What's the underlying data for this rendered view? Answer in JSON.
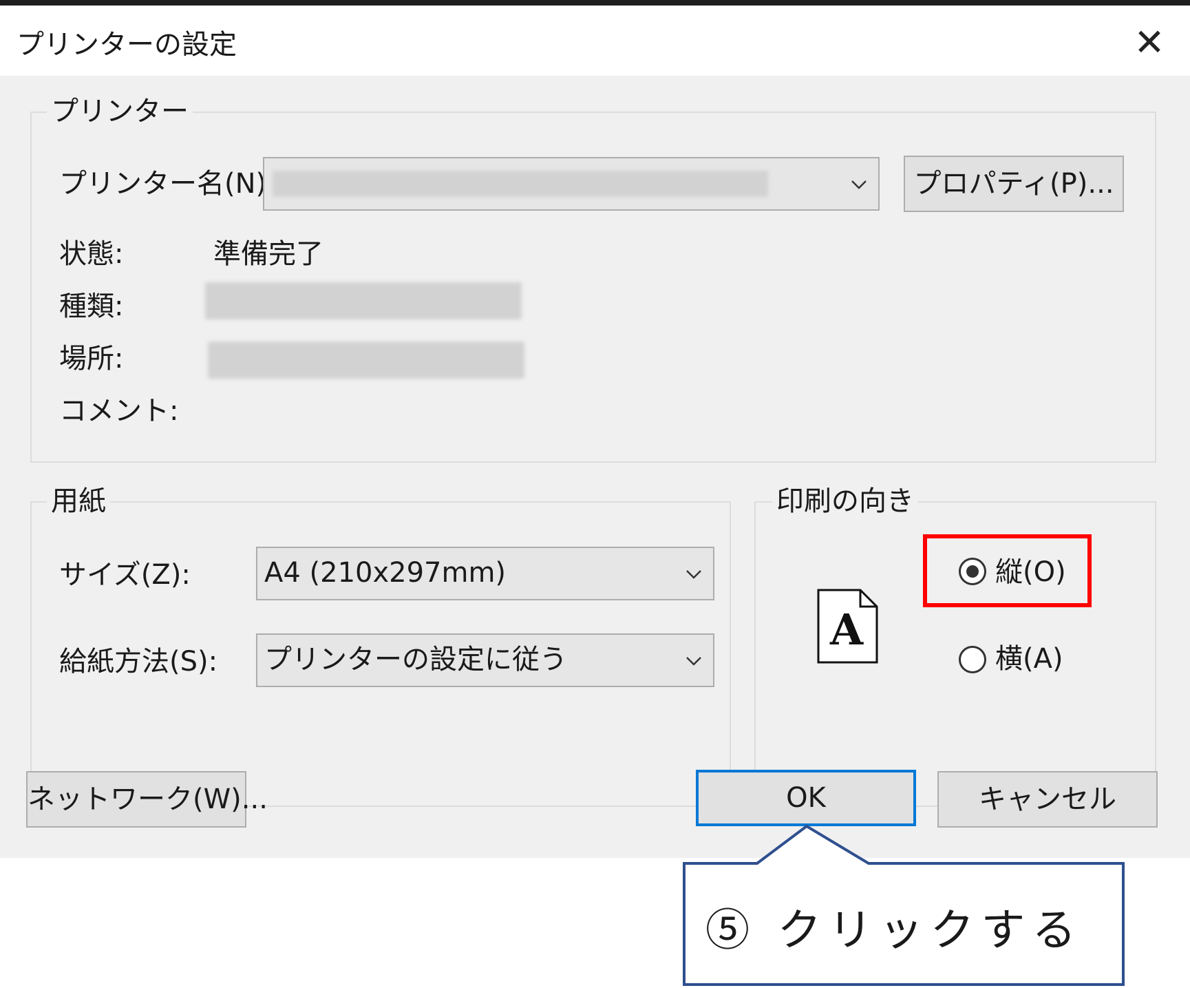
{
  "window": {
    "title": "プリンターの設定",
    "close_glyph": "✕"
  },
  "printer_group": {
    "legend": "プリンター",
    "name_label": "プリンター名(N):",
    "properties_button": "プロパティ(P)...",
    "status_label": "状態:",
    "status_value": "準備完了",
    "type_label": "種類:",
    "location_label": "場所:",
    "comment_label": "コメント:"
  },
  "paper_group": {
    "legend": "用紙",
    "size_label": "サイズ(Z):",
    "size_value": "A4 (210x297mm)",
    "source_label": "給紙方法(S):",
    "source_value": "プリンターの設定に従う"
  },
  "orientation_group": {
    "legend": "印刷の向き",
    "portrait_label": "縦(O)",
    "landscape_label": "横(A)",
    "selected": "portrait",
    "preview_letter": "A"
  },
  "buttons": {
    "network": "ネットワーク(W)...",
    "ok": "OK",
    "cancel": "キャンセル"
  },
  "annotation": {
    "callout_text": "⑤ クリックする",
    "highlight_color": "#ff0000",
    "callout_border_color": "#2f4f8f"
  }
}
